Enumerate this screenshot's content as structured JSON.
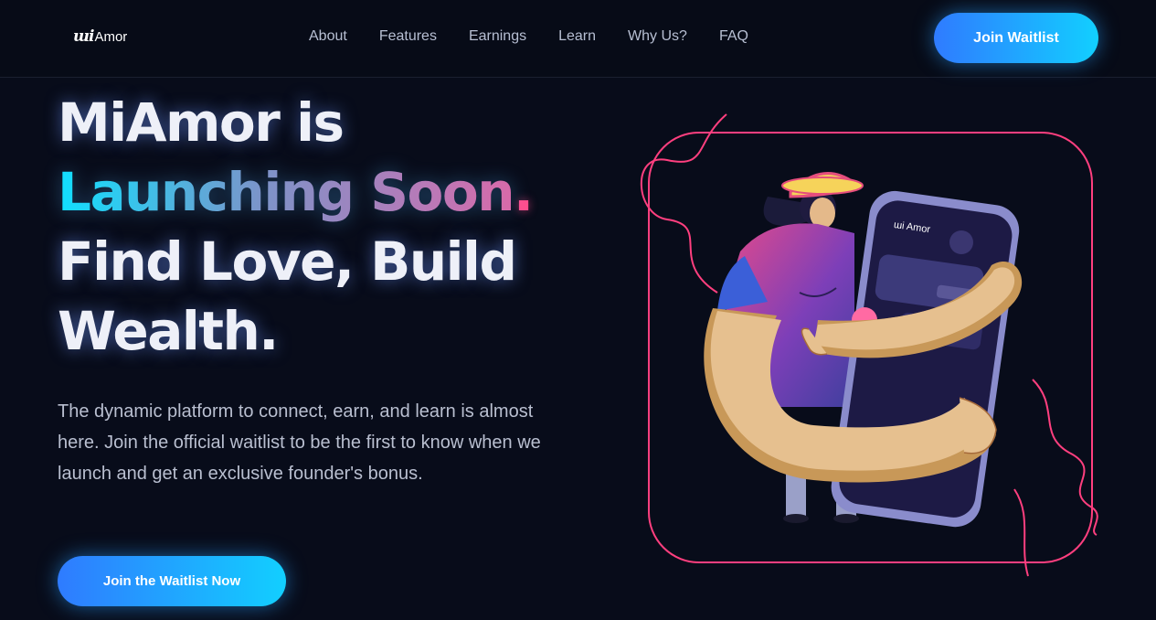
{
  "header": {
    "logo_mark": "ɯi",
    "logo_text": "Amor",
    "nav": [
      "About",
      "Features",
      "Earnings",
      "Learn",
      "Why Us?",
      "FAQ"
    ],
    "cta": "Join Waitlist"
  },
  "hero": {
    "line1": "MiAmor is",
    "line2_gradient": "Launching Soon",
    "line2_dot": ".",
    "line3": "Find Love, Build",
    "line4": "Wealth.",
    "description": "The dynamic platform to connect, earn, and learn is almost here. Join the official waitlist to be the first to know when we launch and get an exclusive founder's bonus.",
    "cta": "Join the Waitlist Now"
  },
  "illustration": {
    "phone_logo": "ɯi Amor"
  },
  "colors": {
    "background": "#080c1a",
    "accent_blue": "#2f7bff",
    "accent_cyan": "#12cfff",
    "accent_pink": "#ff4d8d"
  }
}
